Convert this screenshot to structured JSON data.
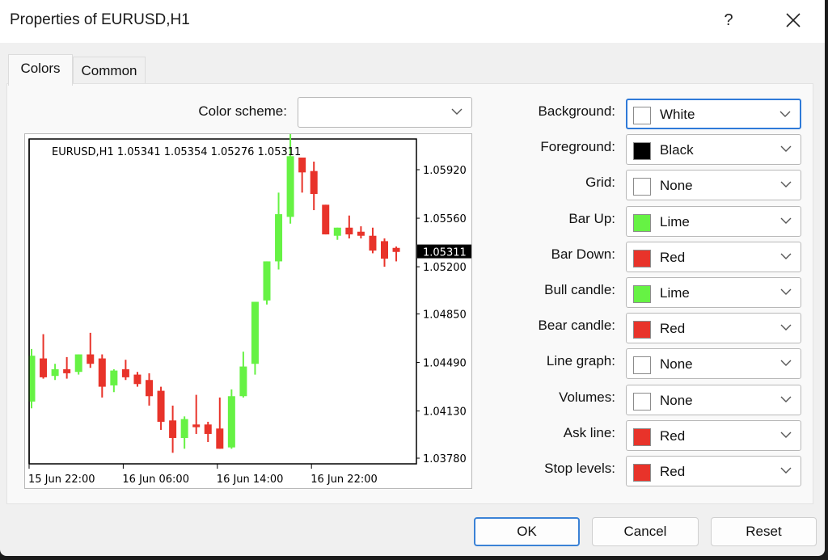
{
  "window": {
    "title": "Properties of EURUSD,H1",
    "help_label": "?",
    "close_icon": "close-icon"
  },
  "tabs": [
    {
      "label": "Colors",
      "active": true
    },
    {
      "label": "Common",
      "active": false
    }
  ],
  "color_scheme": {
    "label": "Color scheme:",
    "value": ""
  },
  "color_settings": [
    {
      "label": "Background:",
      "value": "White",
      "swatch": "#ffffff",
      "focused": true
    },
    {
      "label": "Foreground:",
      "value": "Black",
      "swatch": "#000000"
    },
    {
      "label": "Grid:",
      "value": "None",
      "swatch": "#ffffff"
    },
    {
      "label": "Bar Up:",
      "value": "Lime",
      "swatch": "#66f244"
    },
    {
      "label": "Bar Down:",
      "value": "Red",
      "swatch": "#e8332a"
    },
    {
      "label": "Bull candle:",
      "value": "Lime",
      "swatch": "#66f244"
    },
    {
      "label": "Bear candle:",
      "value": "Red",
      "swatch": "#e8332a"
    },
    {
      "label": "Line graph:",
      "value": "None",
      "swatch": "#ffffff"
    },
    {
      "label": "Volumes:",
      "value": "None",
      "swatch": "#ffffff"
    },
    {
      "label": "Ask line:",
      "value": "Red",
      "swatch": "#e8332a"
    },
    {
      "label": "Stop levels:",
      "value": "Red",
      "swatch": "#e8332a"
    }
  ],
  "buttons": {
    "ok": "OK",
    "cancel": "Cancel",
    "reset": "Reset"
  },
  "chart_data": {
    "type": "candlestick",
    "title": "EURUSD,H1  1.05341 1.05354 1.05276 1.05311",
    "symbol": "EURUSD,H1",
    "ohlc_label": [
      "1.05341",
      "1.05354",
      "1.05276",
      "1.05311"
    ],
    "current_price": "1.05311",
    "ylim": [
      1.037,
      1.062
    ],
    "yticks": [
      "1.05920",
      "1.05560",
      "1.05200",
      "1.04850",
      "1.04490",
      "1.04130",
      "1.03780"
    ],
    "ytick_values": [
      1.0592,
      1.0556,
      1.052,
      1.0485,
      1.0449,
      1.0413,
      1.0378
    ],
    "xticks": [
      {
        "label": "15 Jun 22:00",
        "index": 0
      },
      {
        "label": "16 Jun 06:00",
        "index": 8
      },
      {
        "label": "16 Jun 14:00",
        "index": 16
      },
      {
        "label": "16 Jun 22:00",
        "index": 24
      }
    ],
    "grid": false,
    "bull_color": "#66f244",
    "bear_color": "#e8332a",
    "candles": [
      {
        "o": 1.042,
        "h": 1.0459,
        "l": 1.0415,
        "c": 1.0454
      },
      {
        "o": 1.0452,
        "h": 1.047,
        "l": 1.0437,
        "c": 1.0438
      },
      {
        "o": 1.0439,
        "h": 1.0448,
        "l": 1.0436,
        "c": 1.0444
      },
      {
        "o": 1.0444,
        "h": 1.0453,
        "l": 1.0437,
        "c": 1.0441
      },
      {
        "o": 1.0442,
        "h": 1.0455,
        "l": 1.044,
        "c": 1.0455
      },
      {
        "o": 1.0455,
        "h": 1.0471,
        "l": 1.0445,
        "c": 1.0448
      },
      {
        "o": 1.0452,
        "h": 1.0455,
        "l": 1.0423,
        "c": 1.0431
      },
      {
        "o": 1.0432,
        "h": 1.0444,
        "l": 1.0427,
        "c": 1.0443
      },
      {
        "o": 1.0444,
        "h": 1.0451,
        "l": 1.0436,
        "c": 1.0438
      },
      {
        "o": 1.044,
        "h": 1.0442,
        "l": 1.0431,
        "c": 1.0433
      },
      {
        "o": 1.0436,
        "h": 1.0441,
        "l": 1.0417,
        "c": 1.0424
      },
      {
        "o": 1.0428,
        "h": 1.0431,
        "l": 1.0399,
        "c": 1.0405
      },
      {
        "o": 1.0406,
        "h": 1.0417,
        "l": 1.0382,
        "c": 1.0393
      },
      {
        "o": 1.0393,
        "h": 1.0409,
        "l": 1.0385,
        "c": 1.0407
      },
      {
        "o": 1.0403,
        "h": 1.0425,
        "l": 1.0396,
        "c": 1.0401
      },
      {
        "o": 1.0403,
        "h": 1.0405,
        "l": 1.039,
        "c": 1.0396
      },
      {
        "o": 1.04,
        "h": 1.0423,
        "l": 1.0385,
        "c": 1.0385
      },
      {
        "o": 1.0386,
        "h": 1.0429,
        "l": 1.0385,
        "c": 1.0424
      },
      {
        "o": 1.0424,
        "h": 1.0457,
        "l": 1.0423,
        "c": 1.0446
      },
      {
        "o": 1.0448,
        "h": 1.0477,
        "l": 1.044,
        "c": 1.0494
      },
      {
        "o": 1.0495,
        "h": 1.0519,
        "l": 1.0492,
        "c": 1.0524
      },
      {
        "o": 1.0524,
        "h": 1.0575,
        "l": 1.0518,
        "c": 1.0559
      },
      {
        "o": 1.0557,
        "h": 1.062,
        "l": 1.0552,
        "c": 1.0602
      },
      {
        "o": 1.0601,
        "h": 1.0601,
        "l": 1.0575,
        "c": 1.059
      },
      {
        "o": 1.0591,
        "h": 1.0598,
        "l": 1.0562,
        "c": 1.0574
      },
      {
        "o": 1.0566,
        "h": 1.0566,
        "l": 1.0545,
        "c": 1.0544
      },
      {
        "o": 1.0543,
        "h": 1.0549,
        "l": 1.054,
        "c": 1.0549
      },
      {
        "o": 1.0549,
        "h": 1.0558,
        "l": 1.0541,
        "c": 1.0544
      },
      {
        "o": 1.0546,
        "h": 1.055,
        "l": 1.0541,
        "c": 1.0543
      },
      {
        "o": 1.0543,
        "h": 1.0549,
        "l": 1.053,
        "c": 1.0532
      },
      {
        "o": 1.0539,
        "h": 1.0541,
        "l": 1.052,
        "c": 1.0526
      },
      {
        "o": 1.0534,
        "h": 1.0535,
        "l": 1.0524,
        "c": 1.0531
      }
    ]
  }
}
